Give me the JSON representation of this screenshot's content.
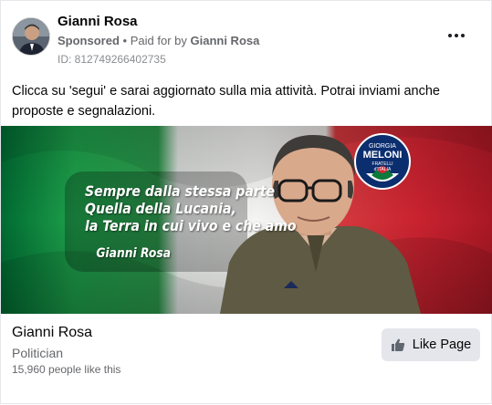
{
  "header": {
    "page_name": "Gianni Rosa",
    "sponsored": "Sponsored",
    "separator": "•",
    "paid_for_prefix": "Paid for by",
    "paid_for_name": "Gianni Rosa",
    "ad_id": "ID: 812749266402735"
  },
  "post": {
    "text": "Clicca su 'segui' e sarai aggiornato sulla mia attività. Potrai inviami anche proposte e segnalazioni."
  },
  "banner": {
    "line1": "Sempre dalla stessa parte",
    "line2": "Quella della Lucania,",
    "line3": "la Terra in cui vivo e che amo",
    "signature": "Gianni Rosa",
    "logo_top": "GIORGIA",
    "logo_main": "MELONI",
    "logo_sub1": "FRATELLI",
    "logo_sub2": "d'ITALIA"
  },
  "footer": {
    "page_name": "Gianni Rosa",
    "category": "Politician",
    "likes": "15,960 people like this",
    "like_button": "Like Page"
  },
  "colors": {
    "flag_green": "#009246",
    "flag_white": "#f1f2f1",
    "flag_red": "#ce2b37",
    "secondary_text": "#65676b",
    "button_bg": "#e4e6eb"
  },
  "icons": [
    "more-options-icon",
    "thumbs-up-icon"
  ]
}
